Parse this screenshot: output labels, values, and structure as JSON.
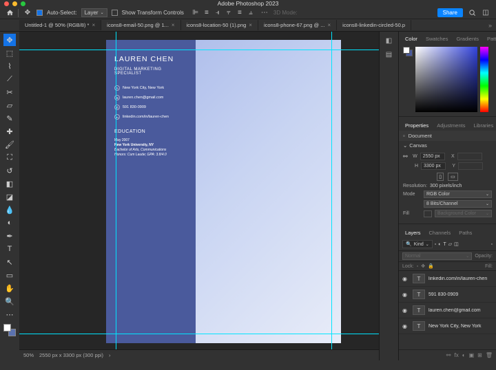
{
  "app_title": "Adobe Photoshop 2023",
  "options": {
    "auto_select": "Auto-Select:",
    "auto_select_value": "Layer",
    "show_transform": "Show Transform Controls",
    "mode_3d": "3D Mode:",
    "share": "Share"
  },
  "tabs": [
    {
      "label": "Untitled-1 @ 50% (RGB/8) *",
      "active": true
    },
    {
      "label": "icons8-email-50.png @ 1...",
      "active": false
    },
    {
      "label": "icons8-location-50 (1).png",
      "active": false
    },
    {
      "label": "icons8-phone-67.png @ ...",
      "active": false
    },
    {
      "label": "icons8-linkedin-circled-50.p",
      "active": false
    }
  ],
  "document": {
    "name": "LAUREN CHEN",
    "subtitle": "DIGITAL MARKETING SPECIALIST",
    "contacts": [
      "New York City, New York",
      "lauren.chen@gmail.com",
      "591 830-0909",
      "linkedin.com/in/lauren-chen"
    ],
    "edu_header": "EDUCATION",
    "edu_date": "May 2007",
    "edu_school": "New York University, NY",
    "edu_degree": "Bachelor of Arts, Communications",
    "edu_honors": "Honors: Cum Laude; GPA: 3.8/4.0"
  },
  "status": {
    "zoom": "50%",
    "dims": "2550 px x 3300 px (300 ppi)"
  },
  "color_tabs": [
    "Color",
    "Swatches",
    "Gradients",
    "Patterns"
  ],
  "prop_tabs": [
    "Properties",
    "Adjustments",
    "Libraries"
  ],
  "properties": {
    "doc_label": "Document",
    "canvas_label": "Canvas",
    "w_label": "W",
    "w_value": "2550 px",
    "x_label": "X",
    "h_label": "H",
    "h_value": "3300 px",
    "y_label": "Y",
    "res_label": "Resolution:",
    "res_value": "300 pixels/inch",
    "mode_label": "Mode",
    "mode_value": "RGB Color",
    "bits_value": "8 Bits/Channel",
    "fill_label": "Fill",
    "fill_value": "Background Color"
  },
  "layers_tabs": [
    "Layers",
    "Channels",
    "Paths"
  ],
  "layers": {
    "kind": "Kind",
    "blend": "Normal",
    "opacity_label": "Opacity:",
    "lock_label": "Lock:",
    "fill_label": "Fill:",
    "items": [
      {
        "name": "linkedin.com/in/lauren-chen",
        "type": "T"
      },
      {
        "name": "591 830-0909",
        "type": "T"
      },
      {
        "name": "lauren.chen@gmail.com",
        "type": "T"
      },
      {
        "name": "New York City, New York",
        "type": "T"
      }
    ]
  }
}
